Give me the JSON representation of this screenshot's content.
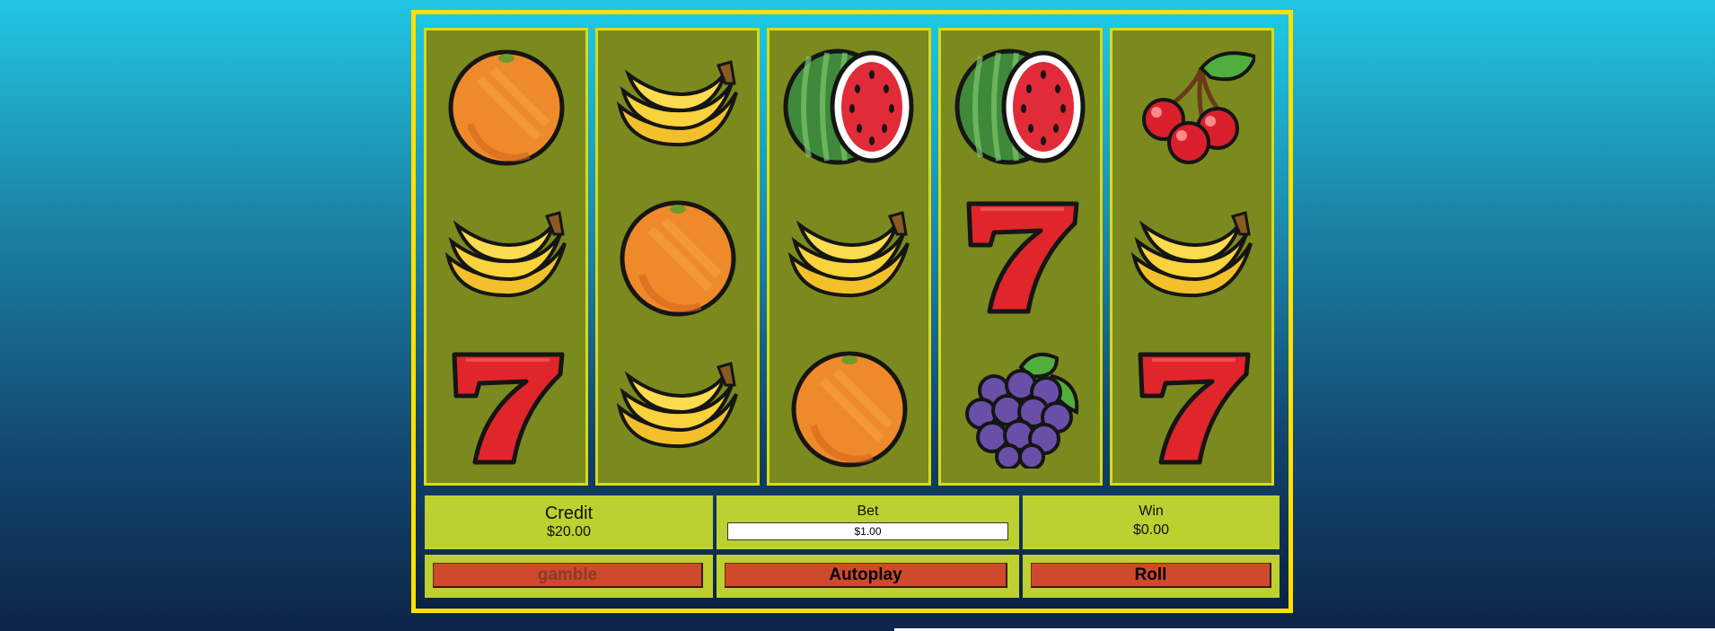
{
  "reels": [
    {
      "symbols": [
        "orange",
        "banana",
        "seven"
      ]
    },
    {
      "symbols": [
        "banana",
        "orange",
        "banana"
      ]
    },
    {
      "symbols": [
        "watermelon",
        "banana",
        "orange"
      ]
    },
    {
      "symbols": [
        "watermelon",
        "seven",
        "grapes"
      ]
    },
    {
      "symbols": [
        "cherries",
        "banana",
        "seven"
      ]
    }
  ],
  "credit": {
    "label": "Credit",
    "value": "$20.00"
  },
  "bet": {
    "label": "Bet",
    "value": "$1.00"
  },
  "win": {
    "label": "Win",
    "value": "$0.00"
  },
  "buttons": {
    "gamble": "gamble",
    "autoplay": "Autoplay",
    "roll": "Roll"
  },
  "colors": {
    "frame": "#ffe000",
    "reel_bg": "#7b8a1e",
    "panel_bg": "#bcd02f",
    "button": "#cf4a2c"
  }
}
